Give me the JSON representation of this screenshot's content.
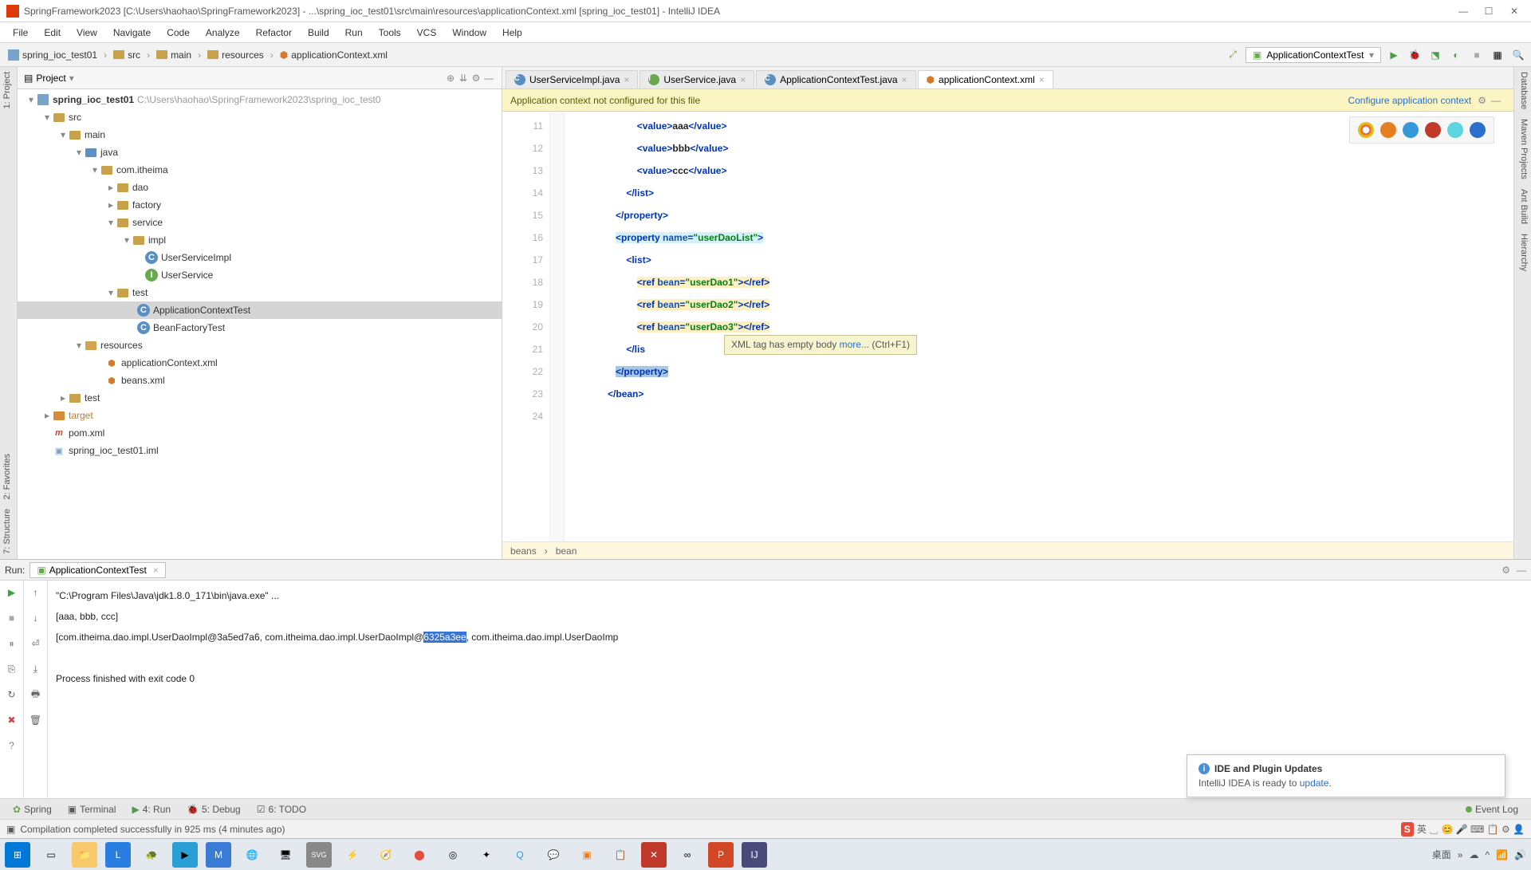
{
  "title": "SpringFramework2023 [C:\\Users\\haohao\\SpringFramework2023] - ...\\spring_ioc_test01\\src\\main\\resources\\applicationContext.xml [spring_ioc_test01] - IntelliJ IDEA",
  "menu": [
    "File",
    "Edit",
    "View",
    "Navigate",
    "Code",
    "Analyze",
    "Refactor",
    "Build",
    "Run",
    "Tools",
    "VCS",
    "Window",
    "Help"
  ],
  "breadcrumb": [
    "spring_ioc_test01",
    "src",
    "main",
    "resources",
    "applicationContext.xml"
  ],
  "run_config": "ApplicationContextTest",
  "project_panel_title": "Project",
  "tree": {
    "root": {
      "name": "spring_ioc_test01",
      "path": "C:\\Users\\haohao\\SpringFramework2023\\spring_ioc_test0"
    },
    "items": [
      {
        "name": "src"
      },
      {
        "name": "main"
      },
      {
        "name": "java"
      },
      {
        "name": "com.itheima"
      },
      {
        "name": "dao"
      },
      {
        "name": "factory"
      },
      {
        "name": "service"
      },
      {
        "name": "impl"
      },
      {
        "name": "UserServiceImpl"
      },
      {
        "name": "UserService"
      },
      {
        "name": "test"
      },
      {
        "name": "ApplicationContextTest"
      },
      {
        "name": "BeanFactoryTest"
      },
      {
        "name": "resources"
      },
      {
        "name": "applicationContext.xml"
      },
      {
        "name": "beans.xml"
      },
      {
        "name": "test"
      },
      {
        "name": "target"
      },
      {
        "name": "pom.xml"
      },
      {
        "name": "spring_ioc_test01.iml"
      }
    ]
  },
  "editor_tabs": [
    {
      "name": "UserServiceImpl.java",
      "active": false
    },
    {
      "name": "UserService.java",
      "active": false
    },
    {
      "name": "ApplicationContextTest.java",
      "active": false
    },
    {
      "name": "applicationContext.xml",
      "active": true
    }
  ],
  "notice": {
    "msg": "Application context not configured for this file",
    "action": "Configure application context"
  },
  "line_start": 11,
  "code_lines": [
    {
      "indent": "              ",
      "parts": [
        {
          "c": "tag",
          "t": "<value>"
        },
        {
          "c": "txt",
          "t": "aaa"
        },
        {
          "c": "tag",
          "t": "</value>"
        }
      ]
    },
    {
      "indent": "              ",
      "parts": [
        {
          "c": "tag",
          "t": "<value>"
        },
        {
          "c": "txt",
          "t": "bbb"
        },
        {
          "c": "tag",
          "t": "</value>"
        }
      ]
    },
    {
      "indent": "              ",
      "parts": [
        {
          "c": "tag",
          "t": "<value>"
        },
        {
          "c": "txt",
          "t": "ccc"
        },
        {
          "c": "tag",
          "t": "</value>"
        }
      ]
    },
    {
      "indent": "          ",
      "parts": [
        {
          "c": "tag",
          "t": "</list>"
        }
      ]
    },
    {
      "indent": "      ",
      "parts": [
        {
          "c": "tag",
          "t": "</property>"
        }
      ]
    },
    {
      "indent": "      ",
      "hl": "cyan",
      "parts": [
        {
          "c": "tag",
          "t": "<property"
        },
        {
          "c": "",
          "t": " "
        },
        {
          "c": "attr",
          "t": "name"
        },
        {
          "c": "tag",
          "t": "="
        },
        {
          "c": "str",
          "t": "\"userDaoList\""
        },
        {
          "c": "tag",
          "t": ">"
        }
      ]
    },
    {
      "indent": "          ",
      "parts": [
        {
          "c": "tag",
          "t": "<list>"
        }
      ]
    },
    {
      "indent": "              ",
      "hl": "yellow",
      "parts": [
        {
          "c": "tag",
          "t": "<ref"
        },
        {
          "c": "",
          "t": " "
        },
        {
          "c": "attr",
          "t": "bean"
        },
        {
          "c": "tag",
          "t": "="
        },
        {
          "c": "str",
          "t": "\"userDao1\""
        },
        {
          "c": "tag",
          "t": ">"
        },
        {
          "c": "tag",
          "t": "</ref>"
        }
      ]
    },
    {
      "indent": "              ",
      "hl": "yellow",
      "parts": [
        {
          "c": "tag",
          "t": "<ref"
        },
        {
          "c": "",
          "t": " "
        },
        {
          "c": "attr",
          "t": "bean"
        },
        {
          "c": "tag",
          "t": "="
        },
        {
          "c": "str",
          "t": "\"userDao2\""
        },
        {
          "c": "tag",
          "t": ">"
        },
        {
          "c": "tag",
          "t": "</ref>"
        }
      ]
    },
    {
      "indent": "              ",
      "hl": "yellow",
      "parts": [
        {
          "c": "tag",
          "t": "<ref"
        },
        {
          "c": "",
          "t": " "
        },
        {
          "c": "attr",
          "t": "bean"
        },
        {
          "c": "tag",
          "t": "="
        },
        {
          "c": "str",
          "t": "\"userDao3\""
        },
        {
          "c": "tag",
          "t": ">"
        },
        {
          "c": "tag",
          "t": "</ref>"
        }
      ]
    },
    {
      "indent": "          ",
      "parts": [
        {
          "c": "tag",
          "t": "</lis"
        }
      ]
    },
    {
      "indent": "      ",
      "hl": "sel",
      "parts": [
        {
          "c": "tag",
          "t": "</property>"
        }
      ]
    },
    {
      "indent": "   ",
      "parts": [
        {
          "c": "tag",
          "t": "</bean>"
        }
      ]
    },
    {
      "indent": "",
      "parts": []
    }
  ],
  "tooltip": {
    "msg": "XML tag has empty body ",
    "link": "more...",
    "hint": " (Ctrl+F1)"
  },
  "editor_breadcrumb": [
    "beans",
    "bean"
  ],
  "run_panel": {
    "label": "Run:",
    "tab": "ApplicationContextTest"
  },
  "console": [
    "\"C:\\Program Files\\Java\\jdk1.8.0_171\\bin\\java.exe\" ...",
    "[aaa, bbb, ccc]",
    "[com.itheima.dao.impl.UserDaoImpl@3a5ed7a6, com.itheima.dao.impl.UserDaoImpl@6325a3ee, com.itheima.dao.impl.UserDaoImp",
    "",
    "Process finished with exit code 0"
  ],
  "console_selection": "6325a3ee",
  "update": {
    "title": "IDE and Plugin Updates",
    "body": "IntelliJ IDEA is ready to ",
    "link": "update",
    "tail": "."
  },
  "bottom_tabs": [
    "Spring",
    "Terminal",
    "4: Run",
    "5: Debug",
    "6: TODO"
  ],
  "event_log": "Event Log",
  "status": "Compilation completed successfully in 925 ms (4 minutes ago)",
  "left_stripe": [
    "1: Project",
    "2: Favorites",
    "7: Structure"
  ],
  "right_stripe": [
    "Database",
    "Maven Projects",
    "Ant Build",
    "Hierarchy"
  ],
  "tray_text": "桌面"
}
